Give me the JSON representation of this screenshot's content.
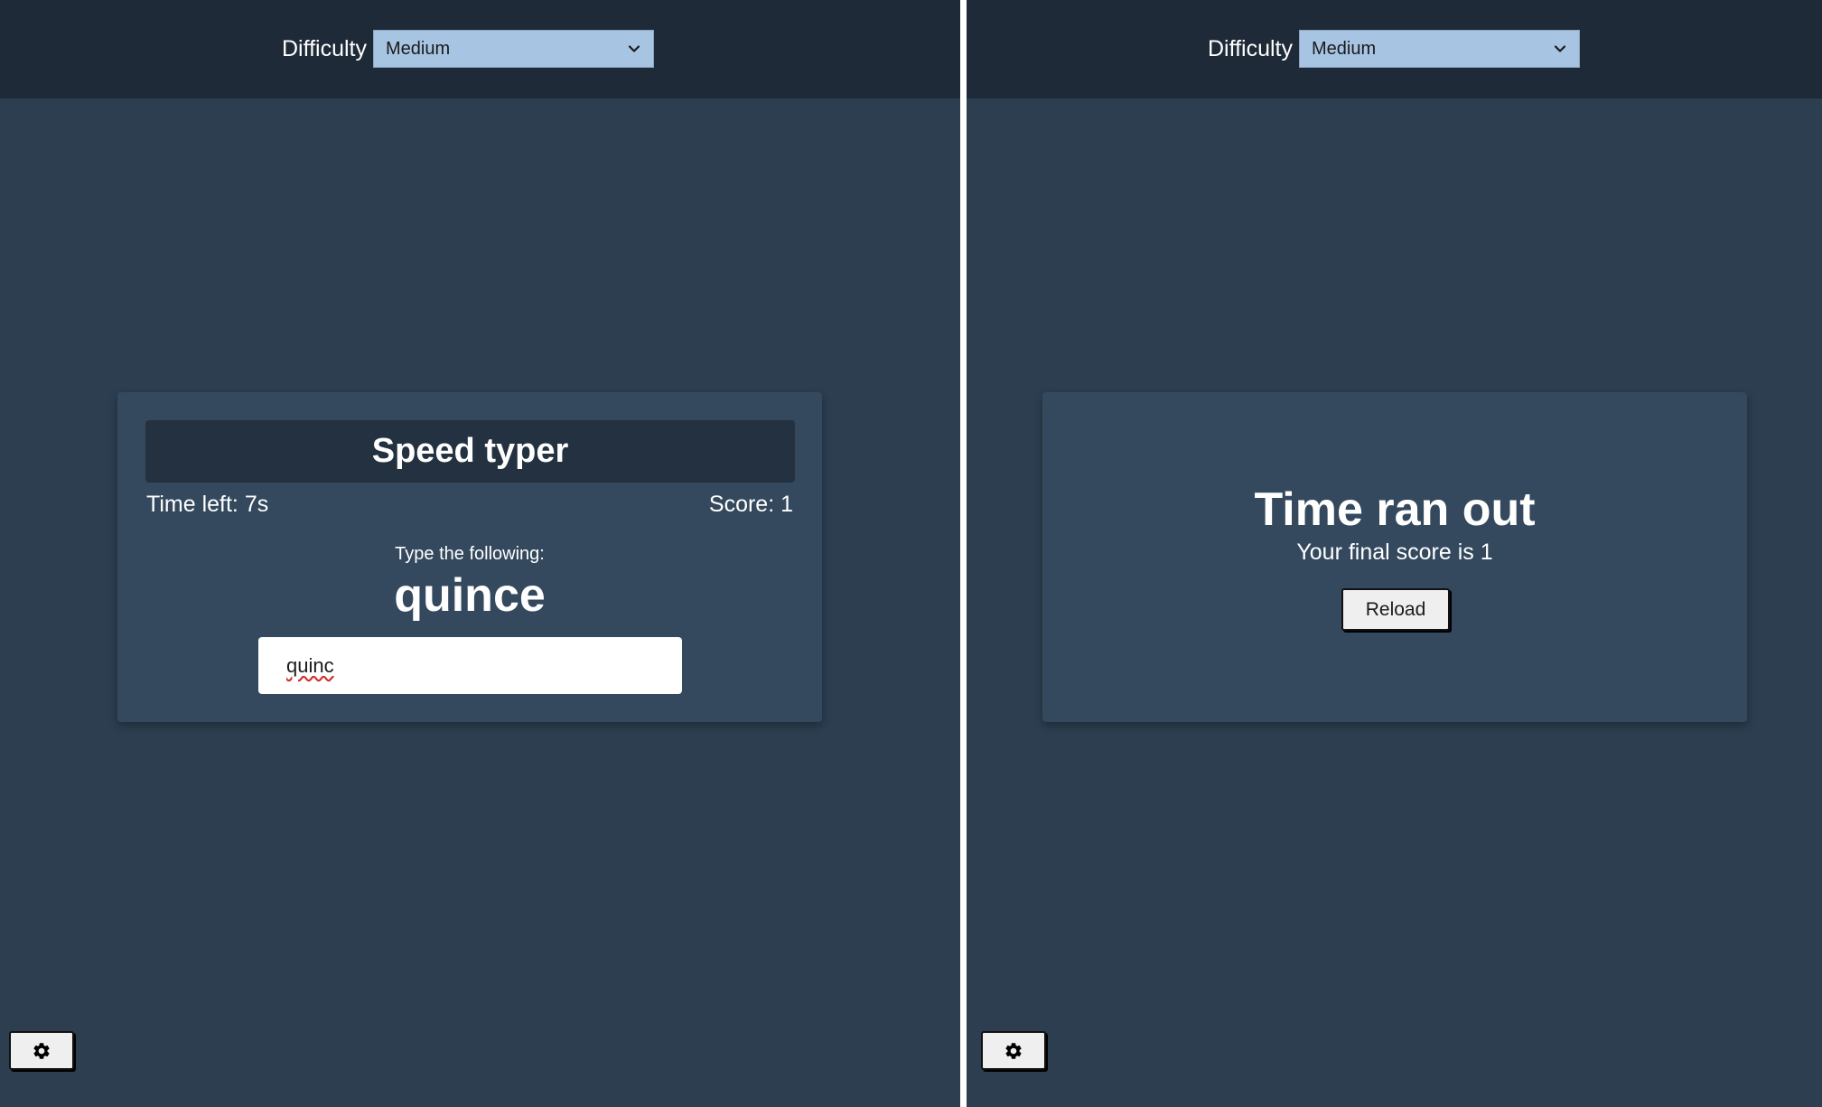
{
  "colors": {
    "background": "#2c3e50",
    "topbar": "#1f2a38",
    "card": "#34495e",
    "card_header": "#233140",
    "select": "#a7c5e3",
    "divider": "#ffffff"
  },
  "left_pane": {
    "topbar": {
      "difficulty_label": "Difficulty",
      "difficulty_value": "Medium",
      "chevron_icon": "chevron-down-icon"
    },
    "game": {
      "title": "Speed typer",
      "time_left": "Time left: 7s",
      "score": "Score: 1",
      "prompt": "Type the following:",
      "word": "quince",
      "input_value": "quinc"
    },
    "settings_icon": "gear-icon"
  },
  "right_pane": {
    "topbar": {
      "difficulty_label": "Difficulty",
      "difficulty_value": "Medium",
      "chevron_icon": "chevron-down-icon"
    },
    "end": {
      "title": "Time ran out",
      "final_score": "Your final score is 1",
      "reload_label": "Reload"
    },
    "settings_icon": "gear-icon"
  }
}
